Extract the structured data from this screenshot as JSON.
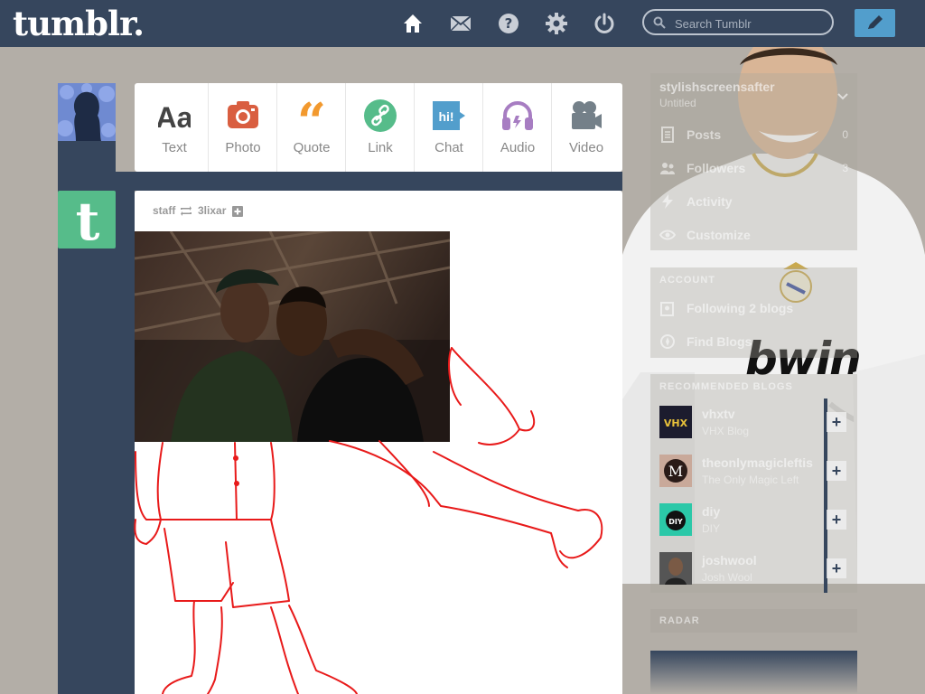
{
  "app": {
    "logo": "tumblr."
  },
  "header": {
    "nav": [
      {
        "name": "home-icon"
      },
      {
        "name": "mail-icon"
      },
      {
        "name": "help-icon"
      },
      {
        "name": "gear-icon"
      },
      {
        "name": "power-icon"
      }
    ],
    "search": {
      "placeholder": "Search Tumblr",
      "value": ""
    },
    "compose": {
      "icon": "pencil-icon"
    }
  },
  "post_types": [
    {
      "label": "Text",
      "icon": "text-icon",
      "color": "#444444"
    },
    {
      "label": "Photo",
      "icon": "camera-icon",
      "color": "#d95e40"
    },
    {
      "label": "Quote",
      "icon": "quote-icon",
      "color": "#f2992e"
    },
    {
      "label": "Link",
      "icon": "link-icon",
      "color": "#56bc8a"
    },
    {
      "label": "Chat",
      "icon": "chat-icon",
      "color": "#529ecc",
      "glyph": "hi!"
    },
    {
      "label": "Audio",
      "icon": "headphones-icon",
      "color": "#a77dc2"
    },
    {
      "label": "Video",
      "icon": "video-camera-icon",
      "color": "#748089"
    }
  ],
  "post": {
    "author": "staff",
    "reblogged_from": "3lixar"
  },
  "sidebar": {
    "blog": {
      "name": "stylishscreensafter",
      "subtitle": "Untitled"
    },
    "blog_items": [
      {
        "label": "Posts",
        "icon": "document-icon",
        "count": "0"
      },
      {
        "label": "Followers",
        "icon": "people-icon",
        "count": "3"
      },
      {
        "label": "Activity",
        "icon": "activity-icon",
        "count": ""
      },
      {
        "label": "Customize",
        "icon": "eye-icon",
        "count": ""
      }
    ],
    "account_heading": "ACCOUNT",
    "account_items": [
      {
        "label": "Following 2 blogs",
        "icon": "following-icon"
      },
      {
        "label": "Find Blogs",
        "icon": "find-blogs-icon"
      }
    ],
    "recommended_heading": "RECOMMENDED BLOGS",
    "recommended": [
      {
        "name": "vhxtv",
        "desc": "VHX Blog",
        "avatar_text": "VHX",
        "avatar_color": "#1c1c2e"
      },
      {
        "name": "theonlymagicleftis",
        "desc": "The Only Magic Left",
        "avatar_text": "M",
        "avatar_color": "#3a2a28"
      },
      {
        "name": "diy",
        "desc": "DIY",
        "avatar_text": "DIY",
        "avatar_color": "#2bc8a8"
      },
      {
        "name": "joshwool",
        "desc": "Josh Wool",
        "avatar_text": "",
        "avatar_color": "#3b3b3b"
      }
    ],
    "radar_heading": "RADAR"
  },
  "overlay": {
    "sponsor": "bwin"
  }
}
